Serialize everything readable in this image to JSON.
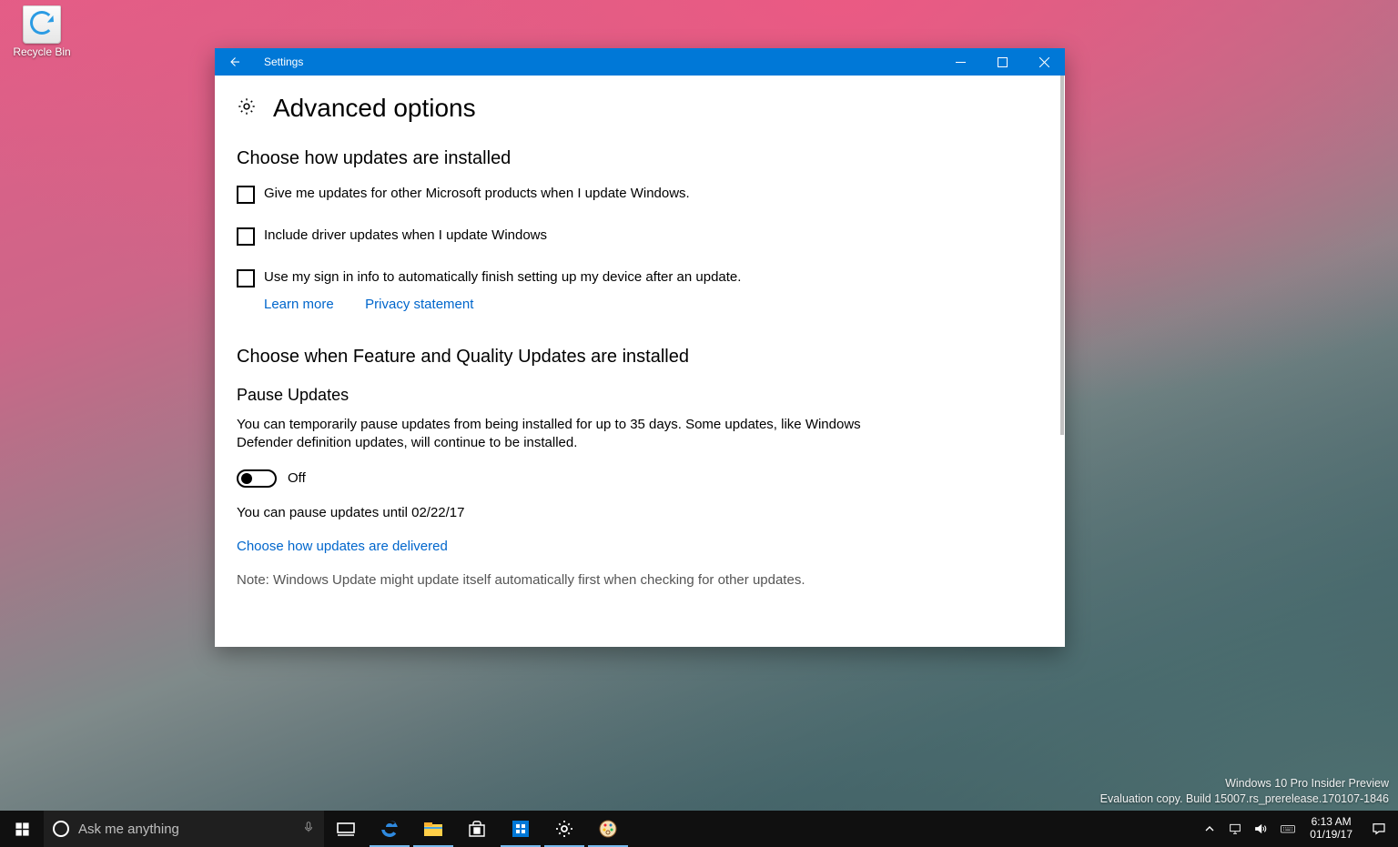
{
  "desktop": {
    "recycle_bin_label": "Recycle Bin"
  },
  "window": {
    "app_title": "Settings",
    "page_title": "Advanced options",
    "sections": {
      "how_installed": {
        "heading": "Choose how updates are installed",
        "check1": "Give me updates for other Microsoft products when I update Windows.",
        "check2": "Include driver updates when I update Windows",
        "check3": "Use my sign in info to automatically finish setting up my device after an update.",
        "learn_more": "Learn more",
        "privacy": "Privacy statement"
      },
      "when_installed": {
        "heading": "Choose when Feature and Quality Updates are installed"
      },
      "pause": {
        "heading": "Pause Updates",
        "body": "You can temporarily pause updates from being installed for up to 35 days. Some updates, like Windows Defender definition updates, will continue to be installed.",
        "toggle_label": "Off",
        "until_text": "You can pause updates until 02/22/17",
        "delivery_link": "Choose how updates are delivered",
        "note": "Note: Windows Update might update itself automatically first when checking for other updates."
      }
    }
  },
  "watermark": {
    "line1": "Windows 10 Pro Insider Preview",
    "line2": "Evaluation copy. Build 15007.rs_prerelease.170107-1846"
  },
  "taskbar": {
    "search_placeholder": "Ask me anything",
    "time": "6:13 AM",
    "date": "01/19/17"
  }
}
